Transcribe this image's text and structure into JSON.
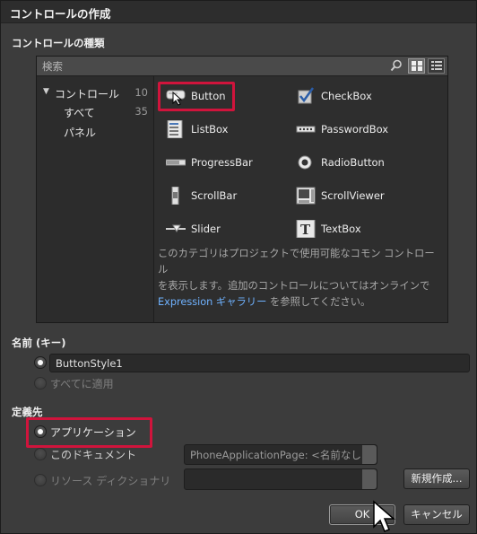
{
  "window": {
    "title": "コントロールの作成"
  },
  "controls_section": {
    "label": "コントロールの種類",
    "search_placeholder": "検索",
    "tree": [
      {
        "label": "コントロール",
        "count": "10",
        "expanded": true
      },
      {
        "label": "すべて",
        "count": "35"
      },
      {
        "label": "パネル",
        "count": ""
      }
    ],
    "items": [
      {
        "label": "Button",
        "icon": "button-icon",
        "selected": true
      },
      {
        "label": "CheckBox",
        "icon": "checkbox-icon"
      },
      {
        "label": "ListBox",
        "icon": "listbox-icon"
      },
      {
        "label": "PasswordBox",
        "icon": "passwordbox-icon"
      },
      {
        "label": "ProgressBar",
        "icon": "progressbar-icon"
      },
      {
        "label": "RadioButton",
        "icon": "radiobutton-icon"
      },
      {
        "label": "ScrollBar",
        "icon": "scrollbar-icon"
      },
      {
        "label": "ScrollViewer",
        "icon": "scrollviewer-icon"
      },
      {
        "label": "Slider",
        "icon": "slider-icon"
      },
      {
        "label": "TextBox",
        "icon": "textbox-icon"
      }
    ],
    "description_line1": "このカテゴリはプロジェクトで使用可能なコモン コントロール",
    "description_line2": "を表示します。追加のコントロールについてはオンラインで",
    "description_link": "Expression ギャラリー",
    "description_line3_suffix": " を参照してください。"
  },
  "name_section": {
    "label": "名前 (キー)",
    "name_value": "ButtonStyle1",
    "apply_all_label": "すべてに適用"
  },
  "define_section": {
    "label": "定義先",
    "option_application": "アプリケーション",
    "option_document": "このドキュメント",
    "option_resource_dictionary": "リソース ディクショナリ",
    "document_value": "PhoneApplicationPage: <名前なし>",
    "new_button": "新規作成..."
  },
  "footer": {
    "ok_label": "OK",
    "cancel_label": "キャンセル"
  },
  "colors": {
    "highlight": "#d0143c",
    "link": "#6fb2ff"
  }
}
